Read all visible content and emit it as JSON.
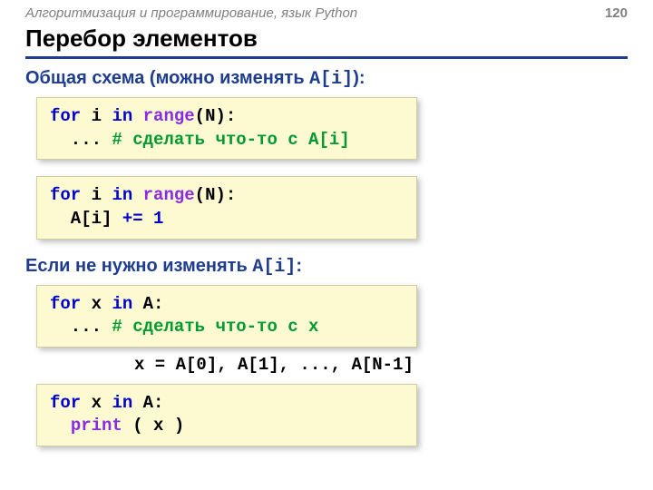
{
  "header": {
    "course": "Алгоритмизация и программирование, язык Python",
    "page": "120"
  },
  "title": "Перебор элементов",
  "sub1": {
    "a": "Общая схема (можно изменять ",
    "b": "A[i]",
    "c": "):"
  },
  "code1": {
    "l1a": "for",
    "l1b": " i ",
    "l1c": "in",
    "l1d": " ",
    "l1e": "range",
    "l1f": "(N):",
    "l2a": "  ... ",
    "l2b": "# сделать что-то c A[i]"
  },
  "code2": {
    "l1a": "for",
    "l1b": " i ",
    "l1c": "in",
    "l1d": " ",
    "l1e": "range",
    "l1f": "(N):",
    "l2a": "  A[i] ",
    "l2b": "+=",
    "l2c": " 1"
  },
  "sub2": {
    "a": "Если не нужно изменять ",
    "b": "A[i]",
    "c": ":"
  },
  "code3": {
    "l1a": "for",
    "l1b": " x ",
    "l1c": "in",
    "l1d": " A:",
    "l2a": "  ... ",
    "l2b": "# сделать что-то c x"
  },
  "annot": "x = A[0], A[1], ..., A[N-1]",
  "code4": {
    "l1a": "for",
    "l1b": " x ",
    "l1c": "in",
    "l1d": " A:",
    "l2a": "  ",
    "l2b": "print",
    "l2c": " ( x )"
  }
}
